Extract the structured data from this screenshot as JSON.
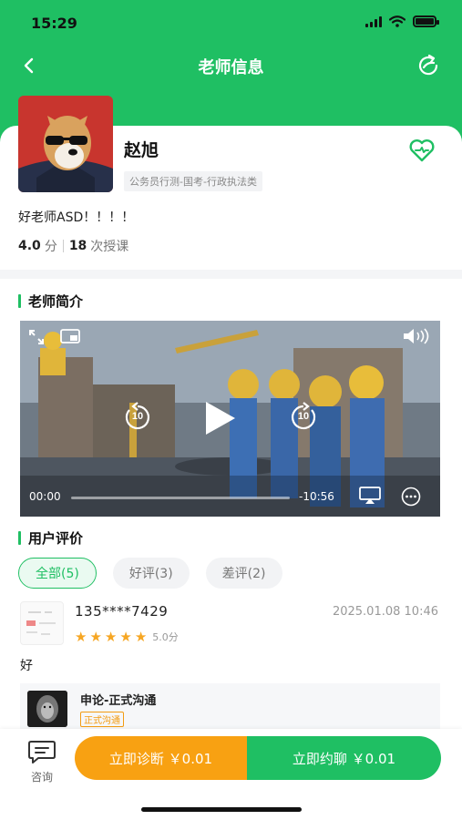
{
  "status_bar": {
    "time": "15:29"
  },
  "nav": {
    "title": "老师信息"
  },
  "teacher": {
    "name": "赵旭",
    "category": "公务员行测-国考-行政执法类",
    "bio": "好老师ASD！！！！",
    "rating": "4.0",
    "rating_unit": "分",
    "lessons": "18",
    "lessons_unit": "次授课"
  },
  "intro_section": {
    "title": "老师简介"
  },
  "video": {
    "time_current": "00:00",
    "time_remaining": "-10:56",
    "skip_back": "10",
    "skip_forward": "10"
  },
  "reviews_section": {
    "title": "用户评价",
    "tabs": [
      {
        "label": "全部(5)",
        "active": true
      },
      {
        "label": "好评(3)",
        "active": false
      },
      {
        "label": "差评(2)",
        "active": false
      }
    ],
    "review": {
      "user": "135****7429",
      "time": "2025.01.08 10:46",
      "stars": 5,
      "score": "5.0分",
      "text": "好",
      "course_name": "申论-正式沟通",
      "course_tag": "正式沟通"
    }
  },
  "bottom_bar": {
    "consult_label": "咨询",
    "diagnose_button": "立即诊断 ￥0.01",
    "chat_button": "立即约聊 ￥0.01"
  },
  "colors": {
    "brand": "#1fbf63",
    "accent": "#f8a112",
    "star": "#f6a623"
  }
}
